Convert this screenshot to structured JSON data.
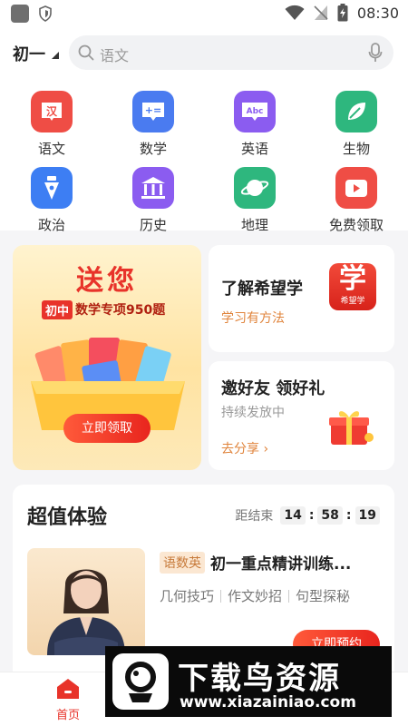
{
  "status_bar": {
    "time": "08:30"
  },
  "top_bar": {
    "grade": "初一",
    "search_placeholder": "语文"
  },
  "categories": [
    {
      "label": "语文",
      "icon": "chinese-book-icon",
      "glyph": "汉",
      "color": "#ef4d45"
    },
    {
      "label": "数学",
      "icon": "math-icon",
      "glyph": "+=",
      "color": "#4a7bf0"
    },
    {
      "label": "英语",
      "icon": "english-icon",
      "glyph": "Abc",
      "color": "#8b5cf0"
    },
    {
      "label": "生物",
      "icon": "leaf-icon",
      "glyph": "",
      "color": "#2eb77e"
    },
    {
      "label": "政治",
      "icon": "pen-nib-icon",
      "glyph": "",
      "color": "#3d7ef3"
    },
    {
      "label": "历史",
      "icon": "temple-icon",
      "glyph": "",
      "color": "#8b5cf0"
    },
    {
      "label": "地理",
      "icon": "planet-icon",
      "glyph": "",
      "color": "#2eb77e"
    },
    {
      "label": "免费领取",
      "icon": "play-gift-icon",
      "glyph": "",
      "color": "#ef4d45"
    }
  ],
  "promo": {
    "title": "送您",
    "tag": "初中",
    "subtitle": "数学专项950题",
    "button": "立即领取"
  },
  "card_learn": {
    "title": "了解希望学",
    "subtitle": "学习有方法",
    "logo_char": "学",
    "logo_text": "希望学"
  },
  "card_invite": {
    "title": "邀好友 领好礼",
    "subtitle": "持续发放中",
    "link": "去分享 ›"
  },
  "deal": {
    "title": "超值体验",
    "countdown_label": "距结束",
    "hours": "14",
    "minutes": "58",
    "seconds": "19",
    "course_tag": "语数英",
    "course_title": "初一重点精讲训练...",
    "features": [
      "几何技巧",
      "作文妙招",
      "句型探秘"
    ],
    "button": "立即预约"
  },
  "tab_bar": {
    "home": "首页"
  },
  "watermark": {
    "title": "下载鸟资源",
    "url": "www.xiazainiao.com"
  }
}
